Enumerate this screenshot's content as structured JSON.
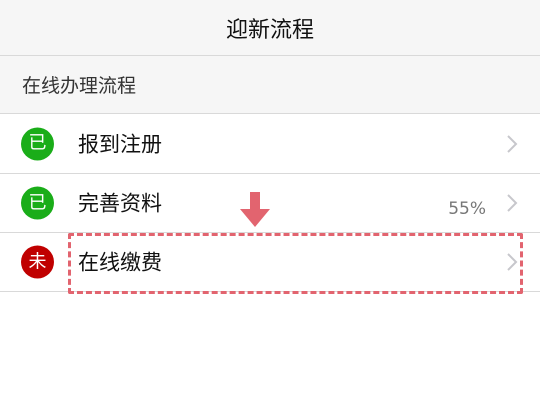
{
  "header": {
    "title": "迎新流程"
  },
  "section": {
    "title": "在线办理流程"
  },
  "steps": [
    {
      "status": "已",
      "status_color": "#1aad19",
      "label": "报到注册",
      "progress": ""
    },
    {
      "status": "已",
      "status_color": "#1aad19",
      "label": "完善资料",
      "progress": "55%"
    },
    {
      "status": "未",
      "status_color": "#c00000",
      "label": "在线缴费",
      "progress": ""
    }
  ],
  "annotation": {
    "color": "#e2646f",
    "arrow_icon": "down-arrow-icon"
  },
  "icons": {
    "row_chevron": "chevron-right-icon"
  }
}
